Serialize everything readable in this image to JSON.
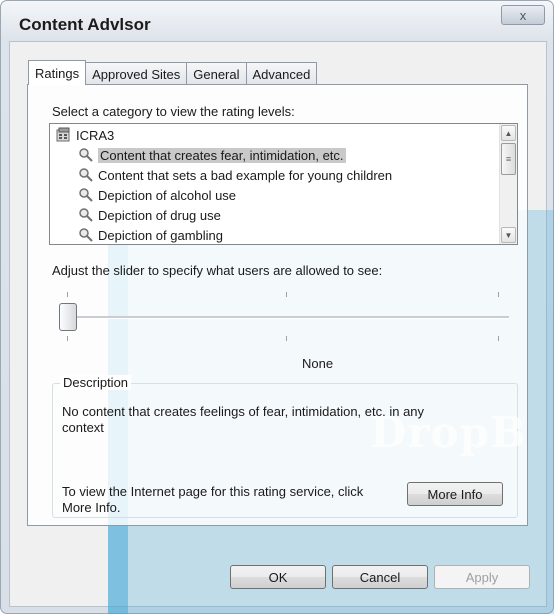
{
  "window": {
    "title": "Content Advlsor",
    "close_glyph": "x"
  },
  "tabs": [
    {
      "label": "Ratings",
      "active": true
    },
    {
      "label": "Approved Sites",
      "active": false
    },
    {
      "label": "General",
      "active": false
    },
    {
      "label": "Advanced",
      "active": false
    }
  ],
  "ratings": {
    "category_prompt": "Select a category to view the rating levels:",
    "categories": [
      {
        "label": "ICRA3",
        "icon": "ratings-service-icon",
        "selected": false
      },
      {
        "label": "Content that creates fear, intimidation, etc.",
        "icon": "magnifier-key-icon",
        "selected": true
      },
      {
        "label": "Content that sets a bad example for young children",
        "icon": "magnifier-key-icon",
        "selected": false
      },
      {
        "label": "Depiction of alcohol use",
        "icon": "magnifier-key-icon",
        "selected": false
      },
      {
        "label": "Depiction of drug use",
        "icon": "magnifier-key-icon",
        "selected": false
      },
      {
        "label": "Depiction of gambling",
        "icon": "magnifier-key-icon",
        "selected": false
      }
    ],
    "slider_prompt": "Adjust the slider to specify what users are allowed to see:",
    "slider_level_index": 0,
    "slider_level_count": 3,
    "level_name": "None",
    "description": {
      "legend": "Description",
      "text": "No content that creates feelings of fear, intimidation, etc. in any context",
      "more_info_text": "To view the Internet page for this rating service, click More Info.",
      "more_info_button": "More Info"
    }
  },
  "buttons": {
    "ok": "OK",
    "cancel": "Cancel",
    "apply": "Apply"
  },
  "watermark": "DropB"
}
